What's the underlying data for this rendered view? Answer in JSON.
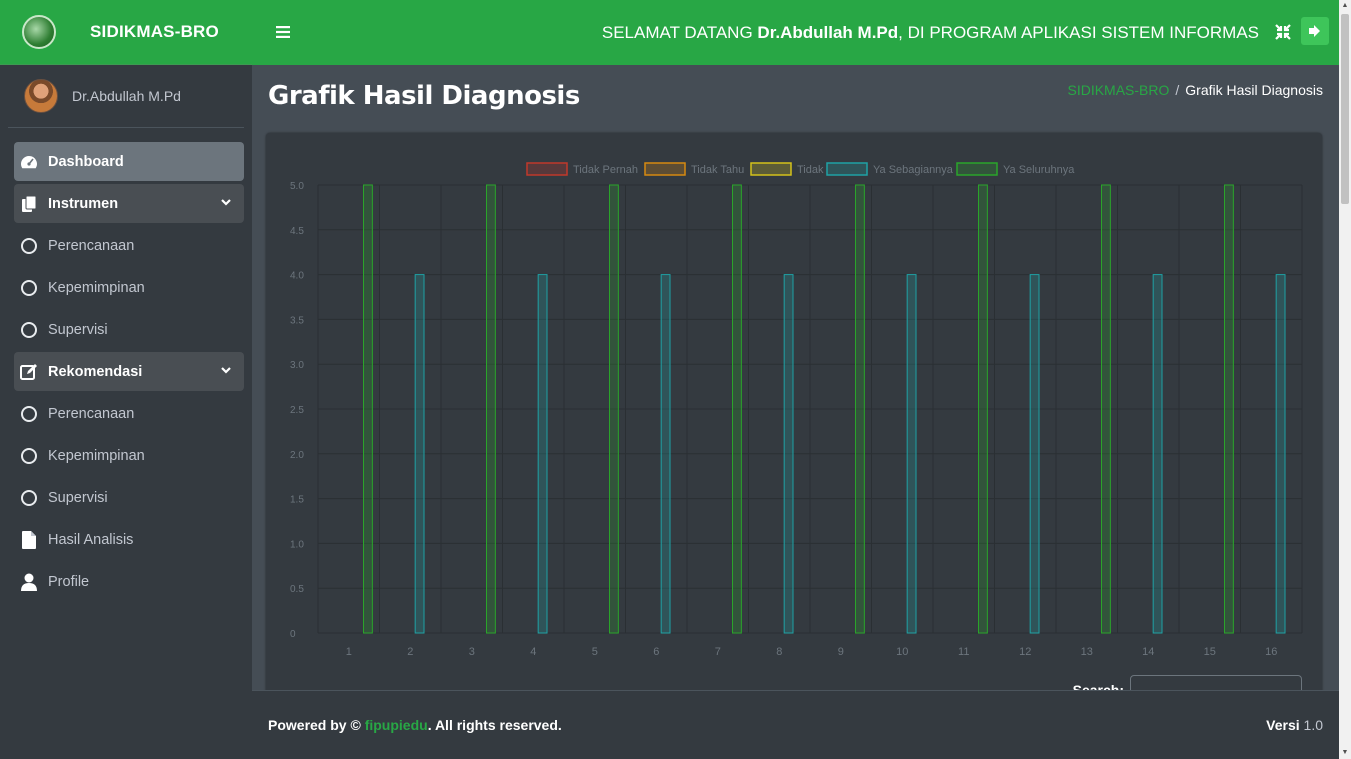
{
  "brand": {
    "title": "SIDIKMAS-BRO"
  },
  "user": {
    "name": "Dr.Abdullah M.Pd"
  },
  "sidebar": {
    "items": [
      {
        "label": "Dashboard",
        "icon": "tachometer-icon",
        "active": true
      },
      {
        "label": "Instrumen",
        "icon": "copy-icon",
        "open": true
      },
      {
        "label": "Perencanaan",
        "icon": "circle-icon"
      },
      {
        "label": "Kepemimpinan",
        "icon": "circle-icon"
      },
      {
        "label": "Supervisi",
        "icon": "circle-icon"
      },
      {
        "label": "Rekomendasi",
        "icon": "edit-icon",
        "open": true
      },
      {
        "label": "Perencanaan",
        "icon": "circle-icon"
      },
      {
        "label": "Kepemimpinan",
        "icon": "circle-icon"
      },
      {
        "label": "Supervisi",
        "icon": "circle-icon"
      },
      {
        "label": "Hasil Analisis",
        "icon": "file-icon"
      },
      {
        "label": "Profile",
        "icon": "user-icon"
      }
    ]
  },
  "topbar": {
    "welcome_prefix": "SELAMAT DATANG ",
    "welcome_name": "Dr.Abdullah M.Pd",
    "welcome_suffix": ", DI PROGRAM APLIKASI SISTEM INFORMAS"
  },
  "page": {
    "title": "Grafik Hasil Diagnosis",
    "breadcrumb_home": "SIDIKMAS-BRO",
    "breadcrumb_sep": "/",
    "breadcrumb_current": "Grafik Hasil Diagnosis"
  },
  "table": {
    "search_label": "Search:"
  },
  "footer": {
    "powered": "Powered by © ",
    "brand": "fipupiedu",
    "rights": ". All rights reserved.",
    "version_label": "Versi",
    "version_value": " 1.0"
  },
  "colors": {
    "primary": "#28a745",
    "sidebar_bg": "#343a40",
    "content_bg": "#454d55"
  },
  "chart_data": {
    "type": "bar",
    "categories": [
      "1",
      "2",
      "3",
      "4",
      "5",
      "6",
      "7",
      "8",
      "9",
      "10",
      "11",
      "12",
      "13",
      "14",
      "15",
      "16"
    ],
    "ylim": [
      0,
      5
    ],
    "yticks": [
      "0",
      "0.5",
      "1.0",
      "1.5",
      "2.0",
      "2.5",
      "3.0",
      "3.5",
      "4.0",
      "4.5",
      "5.0"
    ],
    "legend_position": "top",
    "grid": true,
    "series": [
      {
        "name": "Tidak Pernah",
        "color": "#c0392b",
        "values": [
          0,
          0,
          0,
          0,
          0,
          0,
          0,
          0,
          0,
          0,
          0,
          0,
          0,
          0,
          0,
          0
        ]
      },
      {
        "name": "Tidak Tahu",
        "color": "#d68910",
        "values": [
          0,
          0,
          0,
          0,
          0,
          0,
          0,
          0,
          0,
          0,
          0,
          0,
          0,
          0,
          0,
          0
        ]
      },
      {
        "name": "Tidak",
        "color": "#d4c21a",
        "values": [
          0,
          0,
          0,
          0,
          0,
          0,
          0,
          0,
          0,
          0,
          0,
          0,
          0,
          0,
          0,
          0
        ]
      },
      {
        "name": "Ya Sebagiannya",
        "color": "#1fa2a5",
        "values": [
          0,
          4,
          0,
          4,
          0,
          4,
          0,
          4,
          0,
          4,
          0,
          4,
          0,
          4,
          0,
          4
        ]
      },
      {
        "name": "Ya Seluruhnya",
        "color": "#2aa52a",
        "values": [
          5,
          0,
          5,
          0,
          5,
          0,
          5,
          0,
          5,
          0,
          5,
          0,
          5,
          0,
          5,
          0
        ]
      }
    ]
  }
}
